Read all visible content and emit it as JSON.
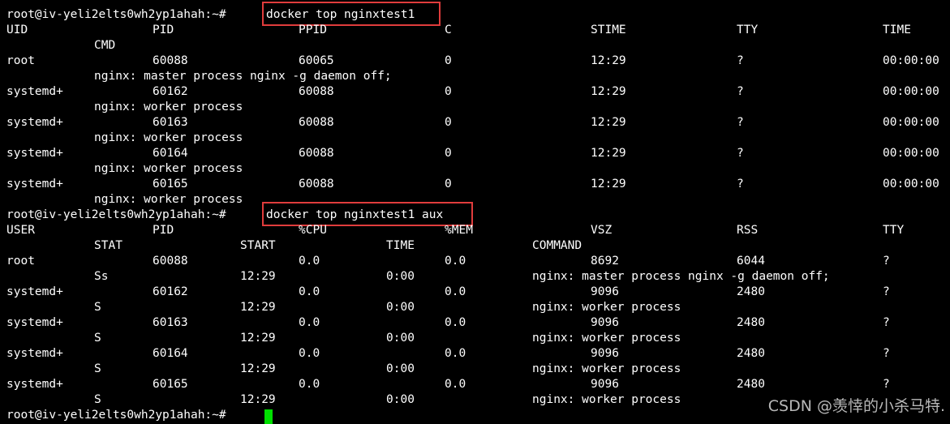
{
  "prompt": "root@iv-yeli2elts0wh2yp1ahah:~#",
  "commands": [
    "docker top nginxtest1",
    "docker top nginxtest1 aux"
  ],
  "top": {
    "header": [
      "UID",
      "PID",
      "PPID",
      "C",
      "STIME",
      "TTY",
      "TIME"
    ],
    "header_cmd": "CMD",
    "rows": [
      {
        "uid": "root",
        "pid": "60088",
        "ppid": "60065",
        "c": "0",
        "stime": "12:29",
        "tty": "?",
        "time": "00:00:00",
        "cmd": "nginx: master process nginx -g daemon off;"
      },
      {
        "uid": "systemd+",
        "pid": "60162",
        "ppid": "60088",
        "c": "0",
        "stime": "12:29",
        "tty": "?",
        "time": "00:00:00",
        "cmd": "nginx: worker process"
      },
      {
        "uid": "systemd+",
        "pid": "60163",
        "ppid": "60088",
        "c": "0",
        "stime": "12:29",
        "tty": "?",
        "time": "00:00:00",
        "cmd": "nginx: worker process"
      },
      {
        "uid": "systemd+",
        "pid": "60164",
        "ppid": "60088",
        "c": "0",
        "stime": "12:29",
        "tty": "?",
        "time": "00:00:00",
        "cmd": "nginx: worker process"
      },
      {
        "uid": "systemd+",
        "pid": "60165",
        "ppid": "60088",
        "c": "0",
        "stime": "12:29",
        "tty": "?",
        "time": "00:00:00",
        "cmd": "nginx: worker process"
      }
    ]
  },
  "aux": {
    "header1": [
      "USER",
      "PID",
      "%CPU",
      "%MEM",
      "VSZ",
      "RSS",
      "TTY"
    ],
    "header2": [
      "STAT",
      "START",
      "TIME",
      "COMMAND"
    ],
    "rows": [
      {
        "user": "root",
        "pid": "60088",
        "cpu": "0.0",
        "mem": "0.0",
        "vsz": "8692",
        "rss": "6044",
        "tty": "?",
        "stat": "Ss",
        "start": "12:29",
        "time": "0:00",
        "command": "nginx: master process nginx -g daemon off;"
      },
      {
        "user": "systemd+",
        "pid": "60162",
        "cpu": "0.0",
        "mem": "0.0",
        "vsz": "9096",
        "rss": "2480",
        "tty": "?",
        "stat": "S",
        "start": "12:29",
        "time": "0:00",
        "command": "nginx: worker process"
      },
      {
        "user": "systemd+",
        "pid": "60163",
        "cpu": "0.0",
        "mem": "0.0",
        "vsz": "9096",
        "rss": "2480",
        "tty": "?",
        "stat": "S",
        "start": "12:29",
        "time": "0:00",
        "command": "nginx: worker process"
      },
      {
        "user": "systemd+",
        "pid": "60164",
        "cpu": "0.0",
        "mem": "0.0",
        "vsz": "9096",
        "rss": "2480",
        "tty": "?",
        "stat": "S",
        "start": "12:29",
        "time": "0:00",
        "command": "nginx: worker process"
      },
      {
        "user": "systemd+",
        "pid": "60165",
        "cpu": "0.0",
        "mem": "0.0",
        "vsz": "9096",
        "rss": "2480",
        "tty": "?",
        "stat": "S",
        "start": "12:29",
        "time": "0:00",
        "command": "nginx: worker process"
      }
    ]
  },
  "watermark": "CSDN @羡悻的小杀马特.",
  "colors": {
    "background": "#000000",
    "text": "#ffffff",
    "highlight_box": "#e03c3c",
    "cursor": "#00e000"
  }
}
